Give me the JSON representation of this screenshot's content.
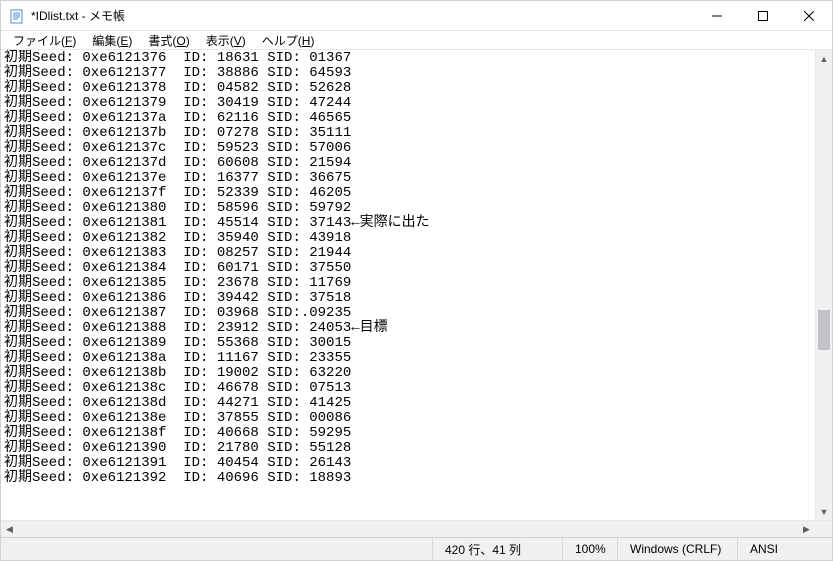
{
  "title": "*IDlist.txt - メモ帳",
  "menus": {
    "file": {
      "label": "ファイル",
      "accel": "F"
    },
    "edit": {
      "label": "編集",
      "accel": "E"
    },
    "format": {
      "label": "書式",
      "accel": "O"
    },
    "view": {
      "label": "表示",
      "accel": "V"
    },
    "help": {
      "label": "ヘルプ",
      "accel": "H"
    }
  },
  "lines": [
    "初期Seed: 0xe6121376  ID: 18631 SID: 01367",
    "初期Seed: 0xe6121377  ID: 38886 SID: 64593",
    "初期Seed: 0xe6121378  ID: 04582 SID: 52628",
    "初期Seed: 0xe6121379  ID: 30419 SID: 47244",
    "初期Seed: 0xe612137a  ID: 62116 SID: 46565",
    "初期Seed: 0xe612137b  ID: 07278 SID: 35111",
    "初期Seed: 0xe612137c  ID: 59523 SID: 57006",
    "初期Seed: 0xe612137d  ID: 60608 SID: 21594",
    "初期Seed: 0xe612137e  ID: 16377 SID: 36675",
    "初期Seed: 0xe612137f  ID: 52339 SID: 46205",
    "初期Seed: 0xe6121380  ID: 58596 SID: 59792",
    "初期Seed: 0xe6121381  ID: 45514 SID: 37143←実際に出た",
    "初期Seed: 0xe6121382  ID: 35940 SID: 43918",
    "初期Seed: 0xe6121383  ID: 08257 SID: 21944",
    "初期Seed: 0xe6121384  ID: 60171 SID: 37550",
    "初期Seed: 0xe6121385  ID: 23678 SID: 11769",
    "初期Seed: 0xe6121386  ID: 39442 SID: 37518",
    "初期Seed: 0xe6121387  ID: 03968 SID:.09235",
    "初期Seed: 0xe6121388  ID: 23912 SID: 24053←目標",
    "初期Seed: 0xe6121389  ID: 55368 SID: 30015",
    "初期Seed: 0xe612138a  ID: 11167 SID: 23355",
    "初期Seed: 0xe612138b  ID: 19002 SID: 63220",
    "初期Seed: 0xe612138c  ID: 46678 SID: 07513",
    "初期Seed: 0xe612138d  ID: 44271 SID: 41425",
    "初期Seed: 0xe612138e  ID: 37855 SID: 00086",
    "初期Seed: 0xe612138f  ID: 40668 SID: 59295",
    "初期Seed: 0xe6121390  ID: 21780 SID: 55128",
    "初期Seed: 0xe6121391  ID: 40454 SID: 26143",
    "初期Seed: 0xe6121392  ID: 40696 SID: 18893"
  ],
  "status": {
    "pos": "420 行、41 列",
    "zoom": "100%",
    "eol": "Windows (CRLF)",
    "enc": "ANSI"
  }
}
